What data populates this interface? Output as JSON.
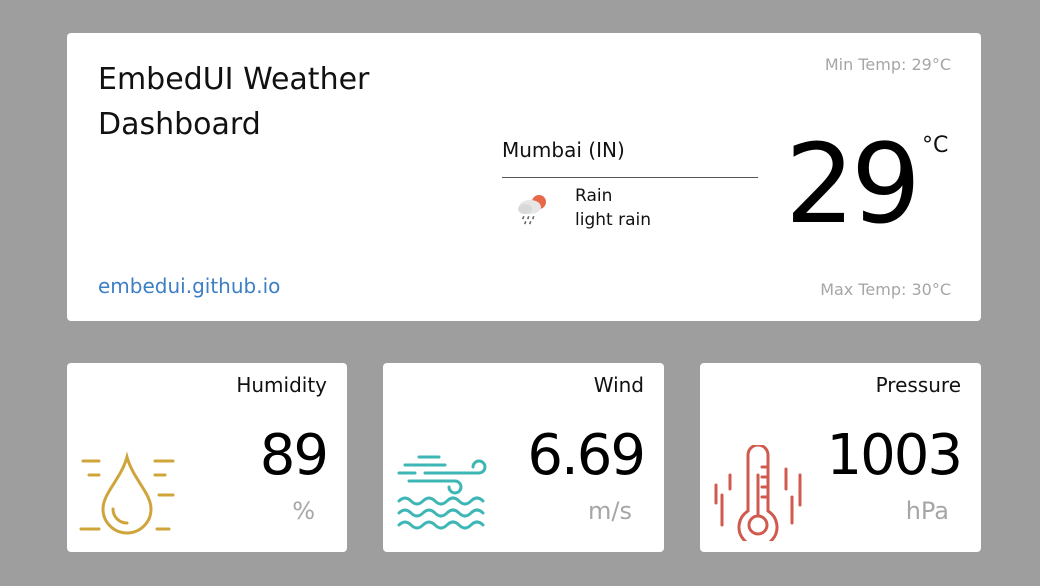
{
  "main": {
    "title": "EmbedUI Weather Dashboard",
    "site_link": "embedui.github.io",
    "min_temp": "Min Temp: 29°C",
    "max_temp": "Max Temp: 30°C",
    "city": "Mumbai (IN)",
    "condition_main": "Rain",
    "condition_desc": "light rain",
    "condition_icon": "rain-cloud-sun-icon",
    "temperature": "29",
    "temp_unit": "°C"
  },
  "stats": {
    "humidity": {
      "label": "Humidity",
      "value": "89",
      "unit": "%",
      "icon": "water-drop-icon",
      "color": "#cfa43a"
    },
    "wind": {
      "label": "Wind",
      "value": "6.69",
      "unit": "m/s",
      "icon": "wind-waves-icon",
      "color": "#3fb6b6"
    },
    "pressure": {
      "label": "Pressure",
      "value": "1003",
      "unit": "hPa",
      "icon": "thermometer-icon",
      "color": "#d05a4e"
    }
  }
}
